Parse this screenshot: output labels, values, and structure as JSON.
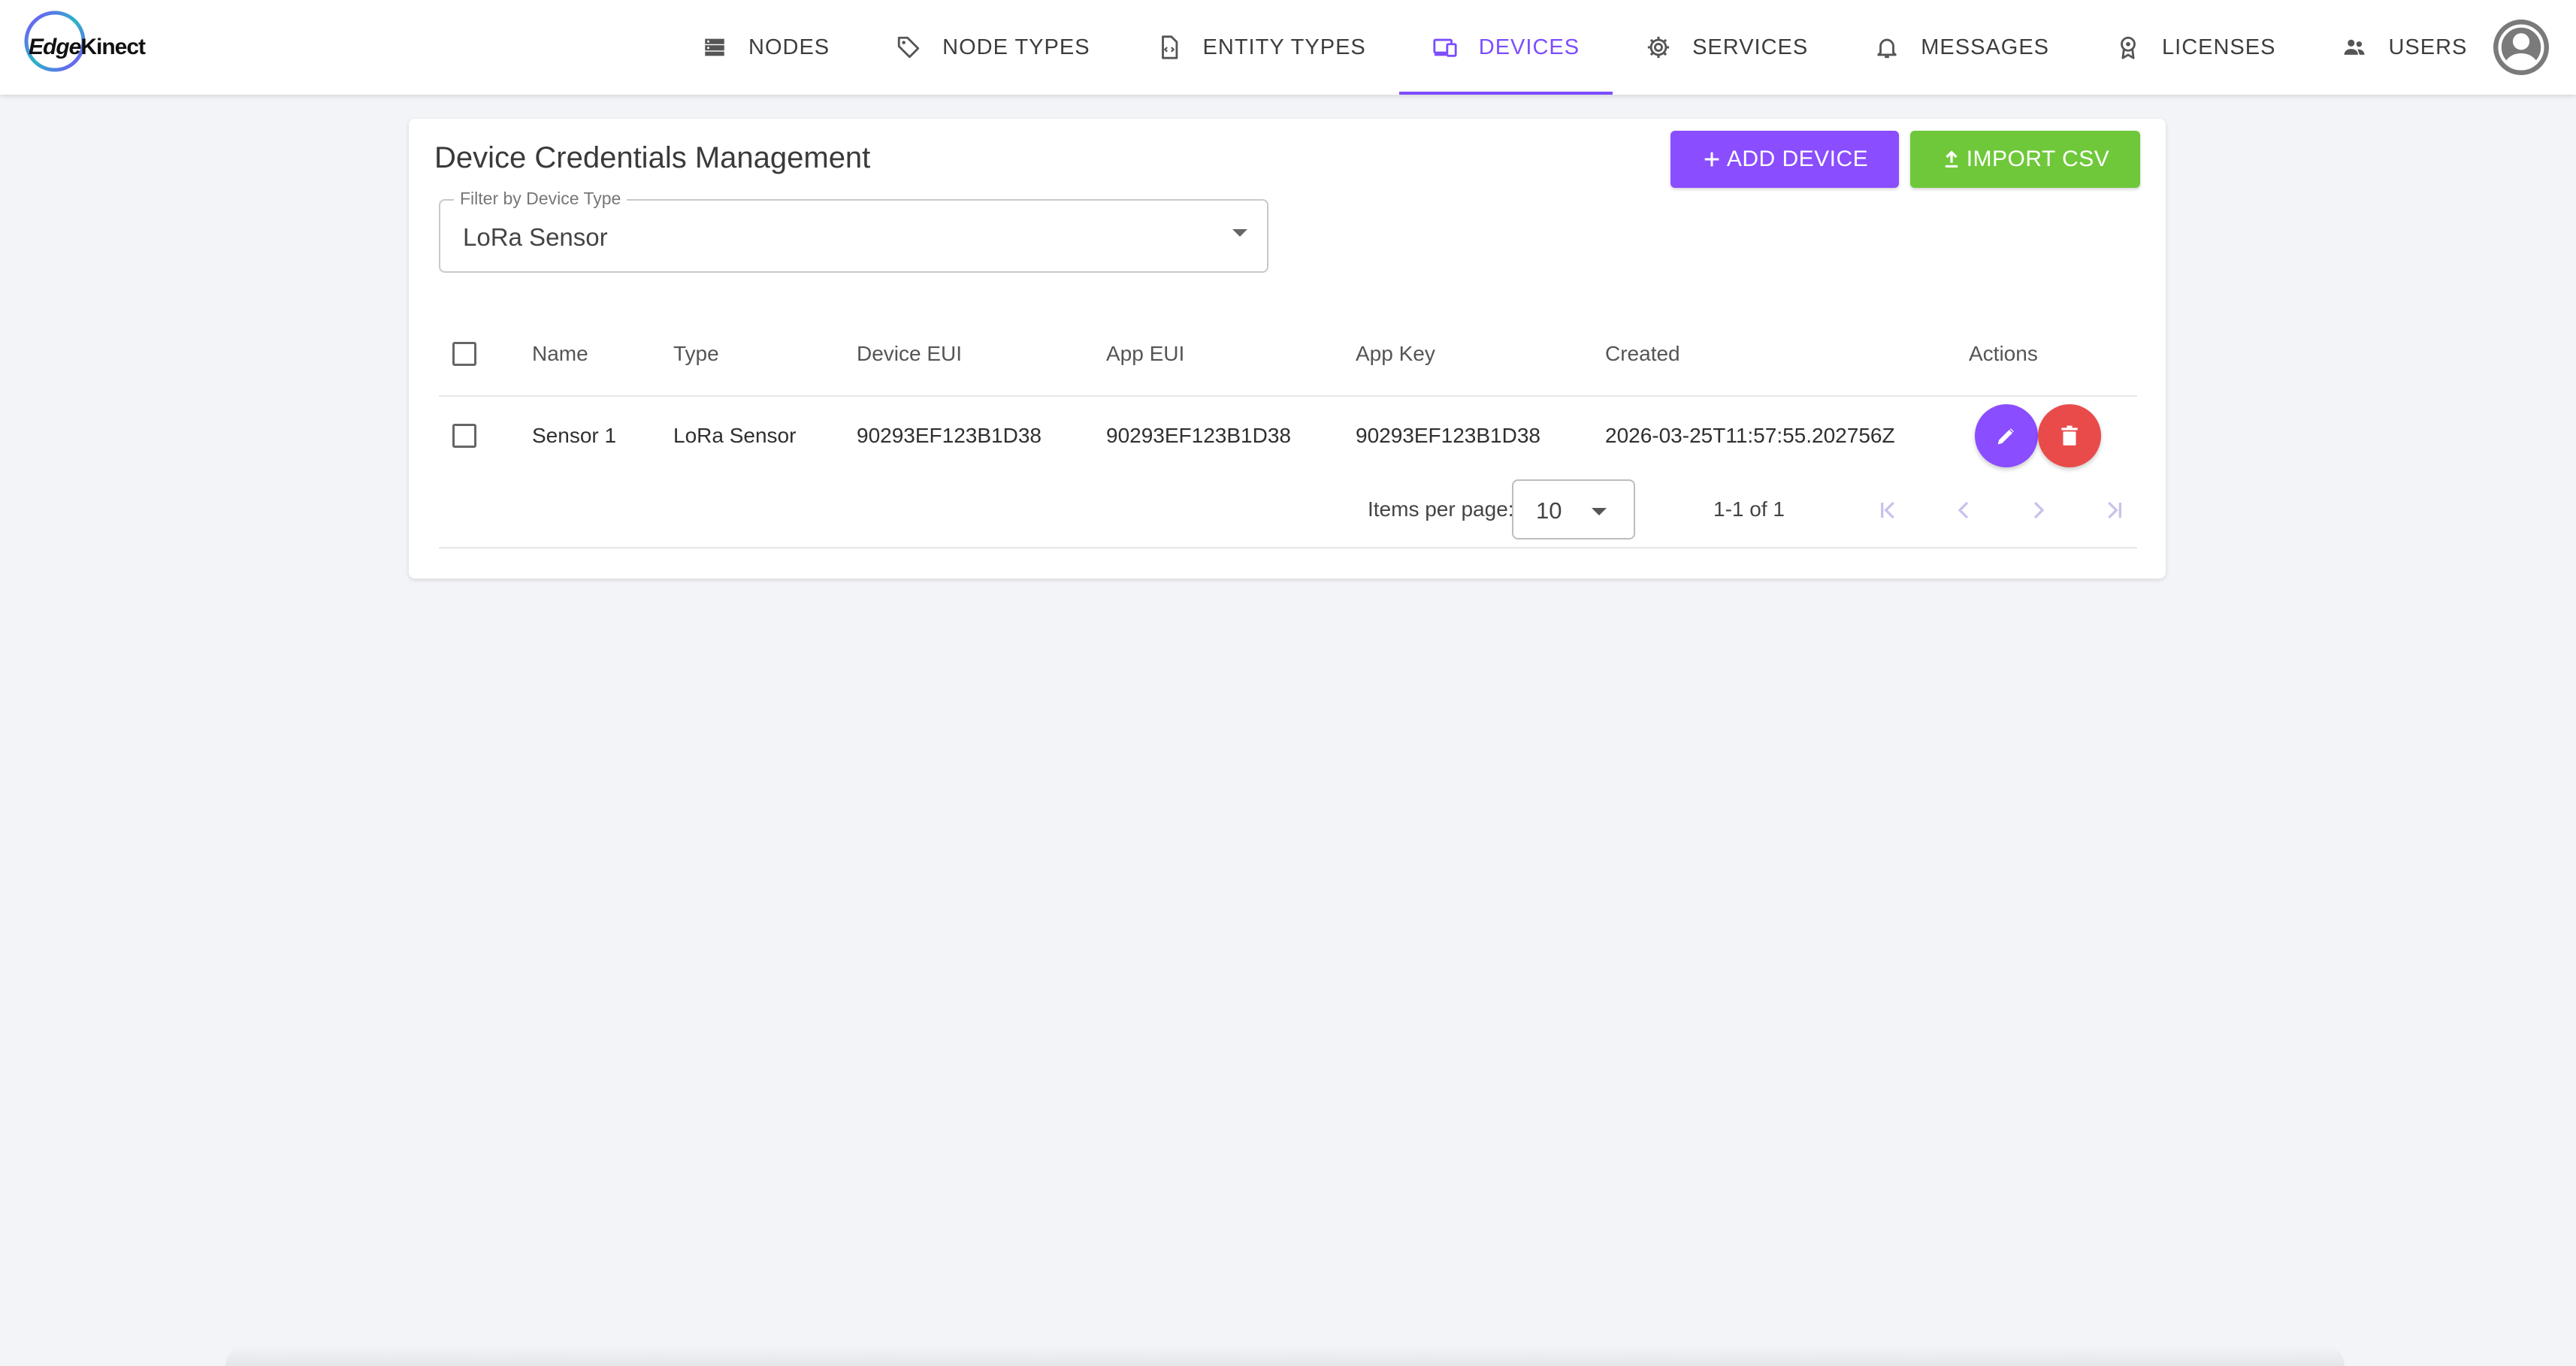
{
  "brand": {
    "logo_text_1": "Edge",
    "logo_text_2": "Kinect",
    "accent": "#7c4dff",
    "success": "#6fc83a",
    "danger": "#e94b4b"
  },
  "nav": {
    "items": [
      {
        "label": "NODES",
        "icon": "server-icon"
      },
      {
        "label": "NODE TYPES",
        "icon": "tag-icon"
      },
      {
        "label": "ENTITY TYPES",
        "icon": "file-code-icon"
      },
      {
        "label": "DEVICES",
        "icon": "devices-icon",
        "active": true
      },
      {
        "label": "SERVICES",
        "icon": "gear-icon"
      },
      {
        "label": "MESSAGES",
        "icon": "bell-icon"
      },
      {
        "label": "LICENSES",
        "icon": "badge-icon"
      },
      {
        "label": "USERS",
        "icon": "users-icon"
      }
    ],
    "account_icon": "account-circle-icon"
  },
  "card": {
    "title": "Device Credentials Management",
    "add_button": "ADD DEVICE",
    "import_button": "IMPORT CSV"
  },
  "filter": {
    "label": "Filter by Device Type",
    "value": "LoRa Sensor"
  },
  "table": {
    "columns": [
      "Name",
      "Type",
      "Device EUI",
      "App EUI",
      "App Key",
      "Created",
      "Actions"
    ],
    "rows": [
      {
        "name": "Sensor 1",
        "type": "LoRa Sensor",
        "device_eui": "90293EF123B1D38",
        "app_eui": "90293EF123B1D38",
        "app_key": "90293EF123B1D38",
        "created": "2026-03-25T11:57:55.202756Z"
      }
    ]
  },
  "paginator": {
    "items_per_page_label": "Items per page:",
    "page_size": "10",
    "range": "1-1 of 1"
  }
}
